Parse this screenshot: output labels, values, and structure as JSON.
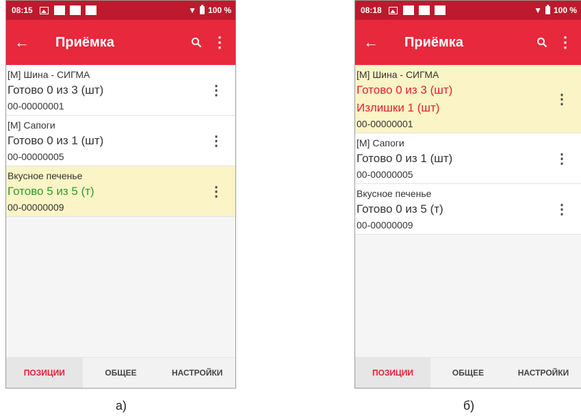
{
  "screens": [
    {
      "status": {
        "time": "08:15",
        "battery": "100 %"
      },
      "appbar": {
        "title": "Приёмка"
      },
      "items": [
        {
          "name": "[М] Шина - СИГМА",
          "lines": [
            "Готово 0 из 3 (шт)"
          ],
          "code": "00-00000001"
        },
        {
          "name": "[М] Сапоги",
          "lines": [
            "Готово 0 из 1 (шт)"
          ],
          "code": "00-00000005"
        },
        {
          "name": "Вкусное печенье",
          "lines": [
            "Готово 5 из 5 (т)"
          ],
          "code": "00-00000009"
        }
      ],
      "tabs": [
        "ПОЗИЦИИ",
        "ОБЩЕЕ",
        "НАСТРОЙКИ"
      ],
      "caption": "а)"
    },
    {
      "status": {
        "time": "08:18",
        "battery": "100 %"
      },
      "appbar": {
        "title": "Приёмка"
      },
      "items": [
        {
          "name": "[М] Шина - СИГМА",
          "lines": [
            "Готово 0 из 3 (шт)",
            "Излишки 1 (шт)"
          ],
          "code": "00-00000001"
        },
        {
          "name": "[М] Сапоги",
          "lines": [
            "Готово 0 из 1 (шт)"
          ],
          "code": "00-00000005"
        },
        {
          "name": "Вкусное печенье",
          "lines": [
            "Готово 0 из 5 (т)"
          ],
          "code": "00-00000009"
        }
      ],
      "tabs": [
        "ПОЗИЦИИ",
        "ОБЩЕЕ",
        "НАСТРОЙКИ"
      ],
      "caption": "б)"
    }
  ],
  "colors": {
    "appbar": "#e8283c",
    "statusbar": "#bd1a2d",
    "highlight": "#faf4c6",
    "complete": "#2f9a2a",
    "error": "#e3202f"
  },
  "icons": {
    "back": "arrow-left-icon",
    "search": "search-icon",
    "more": "more-vert-icon"
  }
}
